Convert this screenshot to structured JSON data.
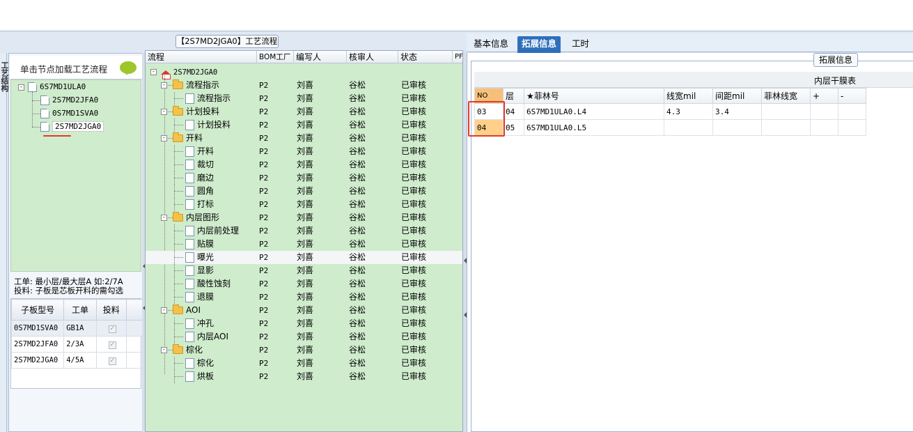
{
  "left_panel": {
    "vertical_tab": "工艺结构",
    "load_hint": "单击节点加载工艺流程",
    "tree": {
      "root": "6S7MD1ULA0",
      "children": [
        "2S7MD2JFA0",
        "0S7MD1SVA0",
        "2S7MD2JGA0"
      ],
      "selected": "2S7MD2JGA0"
    },
    "info_line1": "工单: 最小层/最大层A 如:2/7A",
    "info_line2": "投料: 子板是芯板开料的需勾选",
    "sub_table": {
      "headers": [
        "子板型号",
        "工单",
        "投料"
      ],
      "rows": [
        {
          "model": "0S7MD1SVA0",
          "order": "GB1A",
          "feed": "checked"
        },
        {
          "model": "2S7MD2JFA0",
          "order": "2/3A",
          "feed": "checked"
        },
        {
          "model": "2S7MD2JGA0",
          "order": "4/5A",
          "feed": "checked"
        }
      ]
    }
  },
  "middle_panel": {
    "title": "【2S7MD2JGA0】工艺流程",
    "headers": [
      "流程",
      "BOM工厂",
      "编写人",
      "核审人",
      "状态",
      "PF"
    ],
    "root": "2S7MD2JGA0",
    "rows": [
      {
        "name": "流程指示",
        "type": "folder",
        "bom": "P2",
        "author": "刘喜",
        "reviewer": "谷松",
        "status": "已审核"
      },
      {
        "name": "流程指示",
        "type": "doc",
        "bom": "P2",
        "author": "刘喜",
        "reviewer": "谷松",
        "status": "已审核"
      },
      {
        "name": "计划投料",
        "type": "folder",
        "bom": "P2",
        "author": "刘喜",
        "reviewer": "谷松",
        "status": "已审核"
      },
      {
        "name": "计划投料",
        "type": "doc",
        "bom": "P2",
        "author": "刘喜",
        "reviewer": "谷松",
        "status": "已审核"
      },
      {
        "name": "开料",
        "type": "folder",
        "bom": "P2",
        "author": "刘喜",
        "reviewer": "谷松",
        "status": "已审核"
      },
      {
        "name": "开料",
        "type": "doc",
        "bom": "P2",
        "author": "刘喜",
        "reviewer": "谷松",
        "status": "已审核"
      },
      {
        "name": "裁切",
        "type": "doc",
        "bom": "P2",
        "author": "刘喜",
        "reviewer": "谷松",
        "status": "已审核"
      },
      {
        "name": "磨边",
        "type": "doc",
        "bom": "P2",
        "author": "刘喜",
        "reviewer": "谷松",
        "status": "已审核"
      },
      {
        "name": "圆角",
        "type": "doc",
        "bom": "P2",
        "author": "刘喜",
        "reviewer": "谷松",
        "status": "已审核"
      },
      {
        "name": "打标",
        "type": "doc",
        "bom": "P2",
        "author": "刘喜",
        "reviewer": "谷松",
        "status": "已审核"
      },
      {
        "name": "内层图形",
        "type": "folder",
        "bom": "P2",
        "author": "刘喜",
        "reviewer": "谷松",
        "status": "已审核"
      },
      {
        "name": "内层前处理",
        "type": "doc",
        "bom": "P2",
        "author": "刘喜",
        "reviewer": "谷松",
        "status": "已审核"
      },
      {
        "name": "贴膜",
        "type": "doc",
        "bom": "P2",
        "author": "刘喜",
        "reviewer": "谷松",
        "status": "已审核"
      },
      {
        "name": "曝光",
        "type": "doc",
        "bom": "P2",
        "author": "刘喜",
        "reviewer": "谷松",
        "status": "已审核",
        "highlight": true
      },
      {
        "name": "显影",
        "type": "doc",
        "bom": "P2",
        "author": "刘喜",
        "reviewer": "谷松",
        "status": "已审核"
      },
      {
        "name": "酸性蚀刻",
        "type": "doc",
        "bom": "P2",
        "author": "刘喜",
        "reviewer": "谷松",
        "status": "已审核"
      },
      {
        "name": "退膜",
        "type": "doc",
        "bom": "P2",
        "author": "刘喜",
        "reviewer": "谷松",
        "status": "已审核"
      },
      {
        "name": "AOI",
        "type": "folder",
        "bom": "P2",
        "author": "刘喜",
        "reviewer": "谷松",
        "status": "已审核"
      },
      {
        "name": "冲孔",
        "type": "doc",
        "bom": "P2",
        "author": "刘喜",
        "reviewer": "谷松",
        "status": "已审核"
      },
      {
        "name": "内层AOI",
        "type": "doc",
        "bom": "P2",
        "author": "刘喜",
        "reviewer": "谷松",
        "status": "已审核"
      },
      {
        "name": "棕化",
        "type": "folder",
        "bom": "P2",
        "author": "刘喜",
        "reviewer": "谷松",
        "status": "已审核"
      },
      {
        "name": "棕化",
        "type": "doc",
        "bom": "P2",
        "author": "刘喜",
        "reviewer": "谷松",
        "status": "已审核"
      },
      {
        "name": "烘板",
        "type": "doc",
        "bom": "P2",
        "author": "刘喜",
        "reviewer": "谷松",
        "status": "已审核"
      }
    ]
  },
  "right_panel": {
    "tabs": [
      "基本信息",
      "拓展信息",
      "工时"
    ],
    "active_tab": "拓展信息",
    "group_title": "拓展信息",
    "caption": "内层干膜表",
    "headers": [
      "NO",
      "层",
      "★菲林号",
      "线宽mil",
      "间距mil",
      "菲林线宽",
      "+",
      "-"
    ],
    "rows": [
      {
        "no": "03",
        "layer": "04",
        "film": "6S7MD1ULA0.L4",
        "width": "4.3",
        "spacing": "3.4",
        "film_width": "",
        "plus": "",
        "minus": ""
      },
      {
        "no": "04",
        "layer": "05",
        "film": "6S7MD1ULA0.L5",
        "width": "",
        "spacing": "",
        "film_width": "",
        "plus": "",
        "minus": ""
      }
    ]
  },
  "colors": {
    "tree_bg": "#cfeccd",
    "active_tab": "#2e6fba",
    "highlight_red": "#e23a2c",
    "no_header": "#f7c07a"
  }
}
